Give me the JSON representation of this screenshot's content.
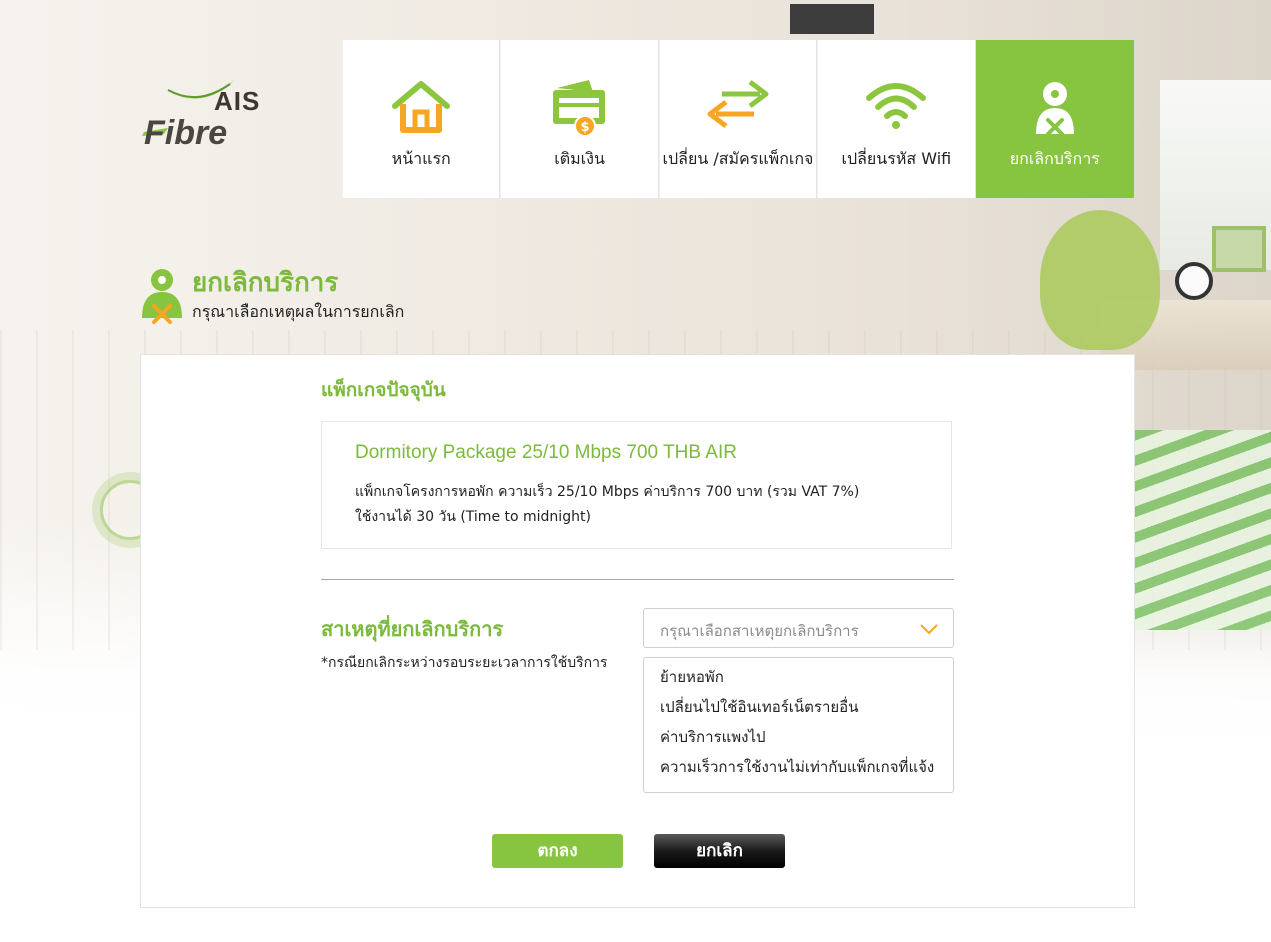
{
  "brand": {
    "logo_ais": "AIS",
    "logo_fibre": "Fibre",
    "accent": "#87c440",
    "text_green": "#7cba3c"
  },
  "nav": {
    "items": [
      {
        "label": "หน้าแรก",
        "icon": "home-icon",
        "active": false
      },
      {
        "label": "เติมเงิน",
        "icon": "topup-card-icon",
        "active": false
      },
      {
        "label": "เปลี่ยน /สมัครแพ็กเกจ",
        "icon": "swap-arrows-icon",
        "active": false
      },
      {
        "label": "เปลี่ยนรหัส Wifi",
        "icon": "wifi-icon",
        "active": false
      },
      {
        "label": "ยกเลิกบริการ",
        "icon": "cancel-service-icon",
        "active": true
      }
    ]
  },
  "header": {
    "title": "ยกเลิกบริการ",
    "subtitle": "กรุณาเลือกเหตุผลในการยกเลิก"
  },
  "current_package": {
    "section_title": "แพ็กเกจปัจจุบัน",
    "name": "Dormitory Package 25/10 Mbps 700 THB AIR",
    "desc_line1": "แพ็กเกจโครงการหอพัก ความเร็ว 25/10 Mbps ค่าบริการ 700 บาท (รวม VAT 7%)",
    "desc_line2": "ใช้งานได้ 30 วัน (Time to midnight)"
  },
  "reason": {
    "title": "สาเหตุที่ยกเลิกบริการ",
    "note": "*กรณียกเลิกระหว่างรอบระยะเวลาการใช้บริการ",
    "select_placeholder": "กรุณาเลือกสาเหตุยกเลิกบริการ",
    "options": [
      "ย้ายหอพัก",
      "เปลี่ยนไปใช้อินเทอร์เน็ตรายอื่น",
      "ค่าบริการแพงไป",
      "ความเร็วการใช้งานไม่เท่ากับแพ็กเกจที่แจ้ง"
    ]
  },
  "buttons": {
    "ok": "ตกลง",
    "cancel": "ยกเลิก"
  }
}
